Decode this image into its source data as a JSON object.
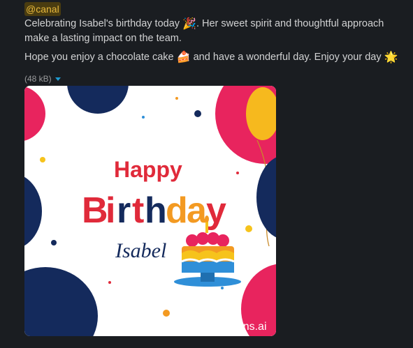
{
  "message": {
    "mention": "@canal",
    "para1_part1": "Celebrating Isabel's birthday today",
    "para1_emoji": "🎉",
    "para1_part2": ". Her sweet spirit and thoughtful approach make a lasting impact on the team.",
    "para2_part1": "Hope you enjoy a chocolate cake",
    "para2_emoji": "🍰",
    "para2_part2": "and have a wonderful day. Enjoy your day",
    "para2_emoji2": "🌟"
  },
  "attachment": {
    "size_label": "(48 kB)",
    "image": {
      "line1": "Happy",
      "line2_letters": [
        "B",
        "i",
        "r",
        "t",
        "h",
        "d",
        "a",
        "y"
      ],
      "name": "Isabel",
      "watermark": "nations.ai",
      "colors": {
        "navy": "#142a5c",
        "pink": "#e8245e",
        "red": "#e02a3a",
        "orange": "#f39a22",
        "yellow": "#f6c31c",
        "blue": "#2f8fd8",
        "balloon": "#f6b91e"
      }
    }
  }
}
